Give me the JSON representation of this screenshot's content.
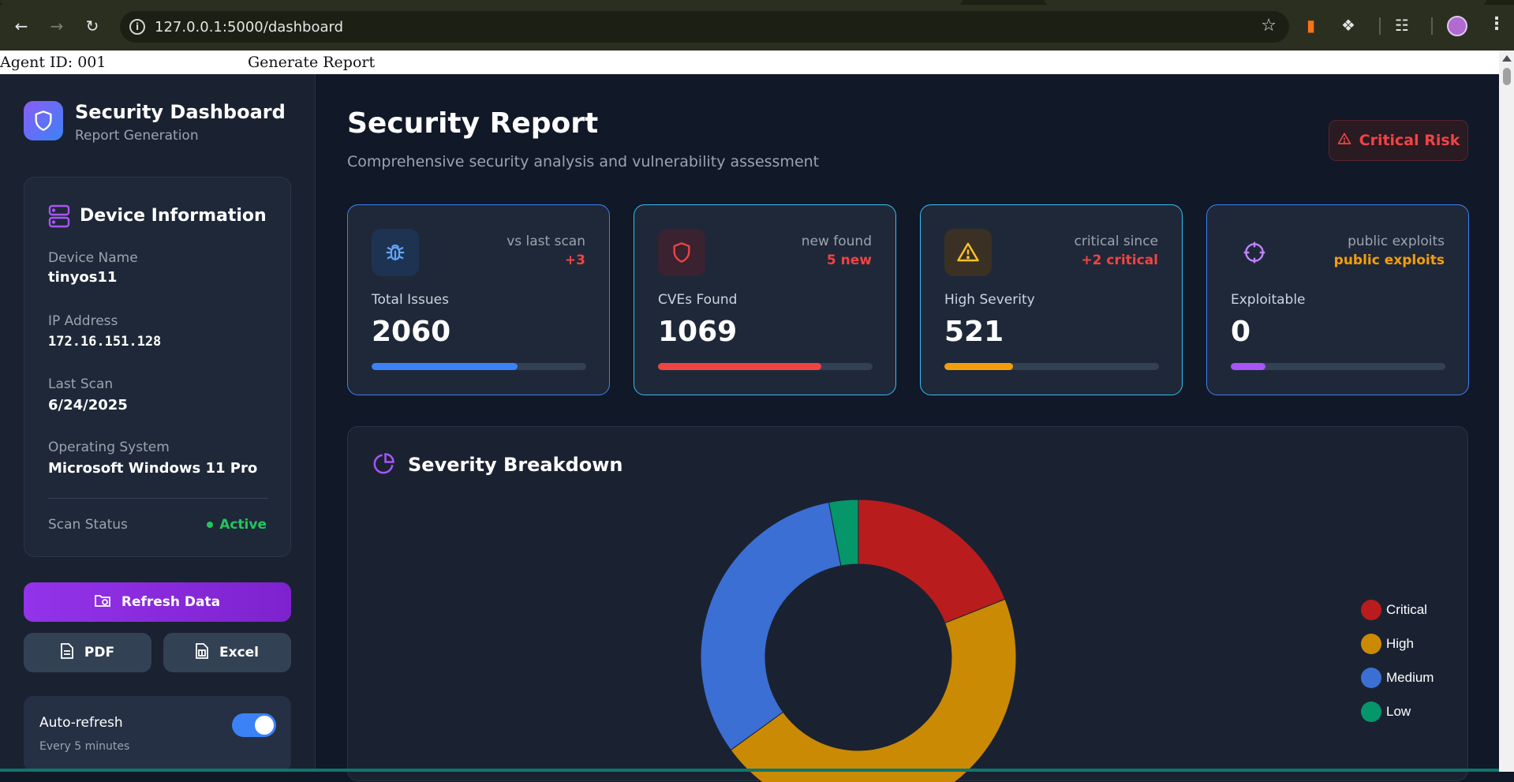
{
  "browser": {
    "url": "127.0.0.1:5000/dashboard"
  },
  "top_strip": {
    "agent": "Agent ID: 001",
    "generate": "Generate Report"
  },
  "sidebar": {
    "brand_title": "Security Dashboard",
    "brand_subtitle": "Report Generation",
    "device": {
      "heading": "Device Information",
      "fields": [
        {
          "label": "Device Name",
          "value": "tinyos11"
        },
        {
          "label": "IP Address",
          "value": "172.16.151.128"
        },
        {
          "label": "Last Scan",
          "value": "6/24/2025"
        },
        {
          "label": "Operating System",
          "value": "Microsoft Windows 11 Pro"
        }
      ],
      "status_label": "Scan Status",
      "status_value": "Active"
    },
    "refresh_label": "Refresh Data",
    "pdf_label": "PDF",
    "excel_label": "Excel",
    "auto_refresh": {
      "label": "Auto-refresh",
      "interval": "Every 5 minutes",
      "enabled": true
    }
  },
  "main": {
    "title": "Security Report",
    "subtitle": "Comprehensive security analysis and vulnerability assessment",
    "risk_badge": "Critical Risk",
    "stats": [
      {
        "label": "Total Issues",
        "value": "2060",
        "delta_label": "vs last scan",
        "delta_value": "+3",
        "delta_color": "#ef4444",
        "icon": "bug-icon",
        "accent": "#3b82f6",
        "progress": 0.68
      },
      {
        "label": "CVEs Found",
        "value": "1069",
        "delta_label": "new found",
        "delta_value": "5 new",
        "delta_color": "#ef4444",
        "icon": "shield-icon",
        "accent": "#ef4444",
        "progress": 0.76
      },
      {
        "label": "High Severity",
        "value": "521",
        "delta_label": "critical since",
        "delta_value": "+2 critical",
        "delta_color": "#ef4444",
        "icon": "warning-icon",
        "accent": "#f59e0b",
        "progress": 0.32
      },
      {
        "label": "Exploitable",
        "value": "0",
        "delta_label": "public exploits",
        "delta_value": "public exploits",
        "delta_color": "#f59e0b",
        "icon": "crosshair-icon",
        "accent": "#a855f7",
        "progress": 0.16
      }
    ],
    "breakdown_title": "Severity Breakdown"
  },
  "chart_data": {
    "type": "pie",
    "categories": [
      "Critical",
      "High",
      "Medium",
      "Low"
    ],
    "values": [
      19,
      46,
      32,
      3
    ],
    "colors": [
      "#b91c1c",
      "#ca8a04",
      "#3b6fd4",
      "#059669"
    ],
    "legend_position": "right"
  }
}
